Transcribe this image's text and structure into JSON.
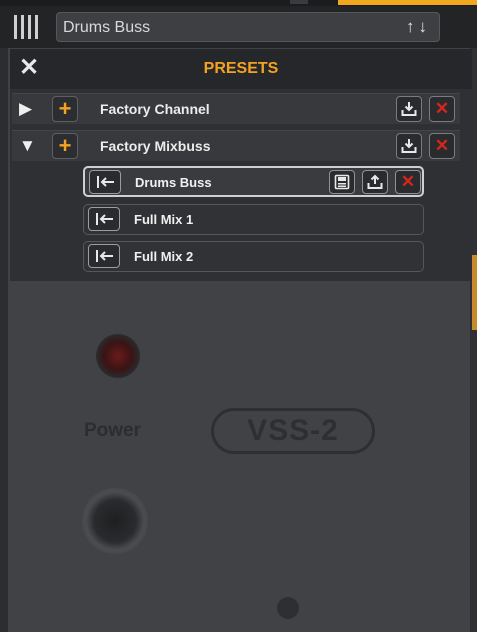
{
  "header": {
    "current_preset": "Drums Buss",
    "nav_arrows": "↑↓"
  },
  "faceplate": {
    "power_label": "Power",
    "model_badge": "VSS-2"
  },
  "presets_panel": {
    "title": "PRESETS",
    "close_glyph": "✕",
    "groups": [
      {
        "label": "Factory Channel",
        "expanded": false,
        "toggle_glyph": "▶",
        "add_glyph": "+",
        "delete_glyph": "✕"
      },
      {
        "label": "Factory Mixbuss",
        "expanded": true,
        "toggle_glyph": "▼",
        "add_glyph": "+",
        "delete_glyph": "✕"
      }
    ],
    "items": [
      {
        "label": "Drums Buss",
        "selected": true,
        "delete_glyph": "✕"
      },
      {
        "label": "Full Mix 1",
        "selected": false
      },
      {
        "label": "Full Mix 2",
        "selected": false
      }
    ]
  },
  "colors": {
    "accent": "#f3a31f",
    "delete": "#d9261c",
    "panel_bg": "#2f3033"
  },
  "icons": [
    "grip-icon",
    "close-icon",
    "expand-triangle-icon",
    "plus-icon",
    "import-icon",
    "delete-icon",
    "load-preset-icon",
    "save-icon",
    "export-icon",
    "up-down-arrows-icon"
  ]
}
